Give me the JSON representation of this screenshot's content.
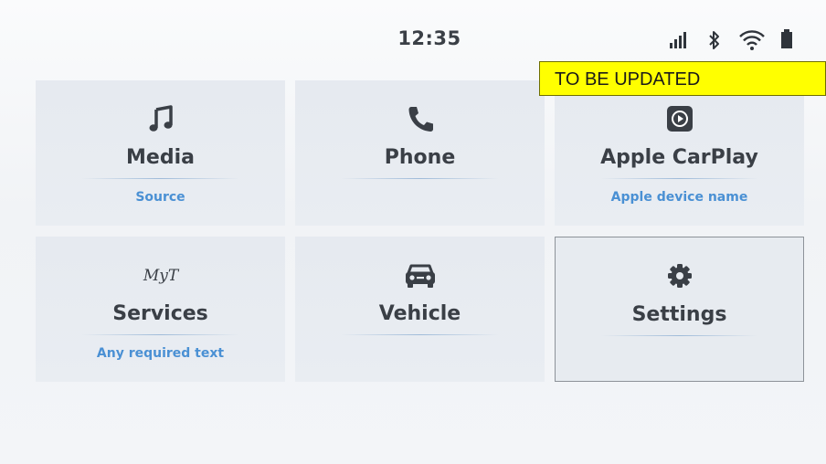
{
  "status_bar": {
    "time": "12:35",
    "icons": [
      "signal-icon",
      "bluetooth-icon",
      "wifi-icon",
      "battery-icon"
    ]
  },
  "banner": {
    "text": "TO BE UPDATED",
    "color": "#ffff00"
  },
  "tiles": [
    {
      "label": "Media",
      "subtitle": "Source",
      "icon": "music-note-icon"
    },
    {
      "label": "Phone",
      "subtitle": "",
      "icon": "phone-icon"
    },
    {
      "label": "Apple CarPlay",
      "subtitle": "Apple device name",
      "icon": "carplay-icon"
    },
    {
      "label": "Services",
      "subtitle": "Any required text",
      "icon": "myt-logo-icon",
      "logo_text": "MyT"
    },
    {
      "label": "Vehicle",
      "subtitle": "",
      "icon": "car-icon"
    },
    {
      "label": "Settings",
      "subtitle": "",
      "icon": "gear-icon",
      "selected": true
    }
  ],
  "colors": {
    "accent": "#4a90d4",
    "text": "#3a3f46",
    "tile": "#e7ebf0"
  }
}
